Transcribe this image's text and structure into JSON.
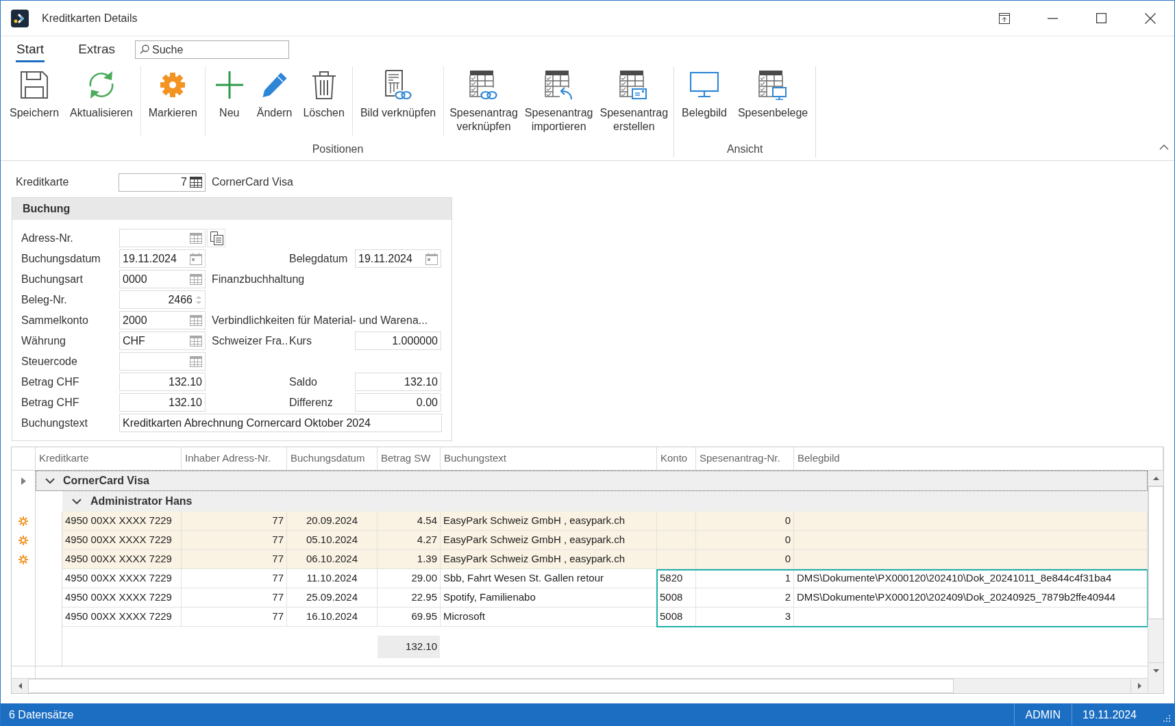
{
  "window": {
    "title": "Kreditkarten Details"
  },
  "ribbon": {
    "tabs": [
      {
        "label": "Start",
        "selected": true
      },
      {
        "label": "Extras",
        "selected": false
      }
    ],
    "search": {
      "placeholder": "Suche"
    },
    "groups": [
      {
        "label": "Positionen",
        "clusters": [
          [
            "Speichern",
            "Aktualisieren"
          ],
          [
            "Markieren"
          ],
          [
            "Neu",
            "Ändern",
            "Löschen"
          ],
          [
            "Bild verknüpfen"
          ],
          [
            "Spesenantrag verknüpfen",
            "Spesenantrag importieren",
            "Spesenantrag erstellen"
          ]
        ]
      },
      {
        "label": "Ansicht",
        "clusters": [
          [
            "Belegbild",
            "Spesenbelege"
          ]
        ]
      }
    ]
  },
  "card": {
    "label": "Kreditkarte",
    "field": {
      "kind": "idlookup",
      "value": "7"
    },
    "description": "CornerCard Visa"
  },
  "booking": {
    "title": "Buchung",
    "rows": [
      {
        "label": "Adress-Nr.",
        "field": {
          "kind": "lookup"
        },
        "action_button": true
      },
      {
        "label": "Buchungsdatum",
        "field": {
          "kind": "date",
          "value": "19.11.2024"
        },
        "action_button": false,
        "right": {
          "label": "Belegdatum",
          "field": {
            "kind": "date",
            "value": "19.11.2024"
          }
        }
      },
      {
        "label": "Buchungsart",
        "field": {
          "kind": "lookup",
          "value": "0000"
        },
        "action_button": false,
        "description": "Finanzbuchhaltung"
      },
      {
        "label": "Beleg-Nr.",
        "field": {
          "kind": "spinner",
          "value": "2466"
        },
        "action_button": false
      },
      {
        "label": "Sammelkonto",
        "field": {
          "kind": "lookup",
          "value": "2000"
        },
        "action_button": false,
        "description": "Verbindlichkeiten für Material- und Warena..."
      },
      {
        "label": "Währung",
        "field": {
          "kind": "lookup",
          "value": "CHF"
        },
        "action_button": false,
        "description": "Schweizer Fra..",
        "right": {
          "label": "Kurs",
          "field": {
            "kind": "amount",
            "value": "1.000000"
          }
        }
      },
      {
        "label": "Steuercode",
        "field": {
          "kind": "lookup"
        },
        "action_button": false
      },
      {
        "label": "Betrag CHF",
        "field": {
          "kind": "amount",
          "value": "132.10"
        },
        "action_button": false,
        "right": {
          "label": "Saldo",
          "field": {
            "kind": "amount",
            "value": "132.10"
          }
        }
      },
      {
        "label": "Betrag CHF",
        "field": {
          "kind": "amount",
          "value": "132.10"
        },
        "action_button": false,
        "right": {
          "label": "Differenz",
          "field": {
            "kind": "amount",
            "value": "0.00"
          }
        }
      },
      {
        "label": "Buchungstext",
        "field": {
          "kind": "text",
          "value": "Kreditkarten Abrechnung Cornercard Oktober 2024"
        },
        "action_button": false
      }
    ]
  },
  "grid": {
    "columns": [
      "Kreditkarte",
      "Inhaber Adress-Nr.",
      "Buchungsdatum",
      "Betrag SW",
      "Buchungstext",
      "Konto",
      "Spesenantrag-Nr.",
      "Belegbild"
    ],
    "groups": [
      {
        "label": "CornerCard Visa",
        "expanded": true,
        "focused": true,
        "children": [
          {
            "label": "Administrator Hans",
            "expanded": true,
            "focused": false,
            "total": "132.10",
            "rows": [
              {
                "card": "4950 00XX XXXX 7229",
                "holder": "77",
                "date": "20.09.2024",
                "amount": "4.54",
                "text": "EasyPark Schweiz GmbH , easypark.ch",
                "request_no": "0",
                "marked": true,
                "selected": false
              },
              {
                "card": "4950 00XX XXXX 7229",
                "holder": "77",
                "date": "05.10.2024",
                "amount": "4.27",
                "text": "EasyPark Schweiz GmbH , easypark.ch",
                "request_no": "0",
                "marked": true,
                "selected": false
              },
              {
                "card": "4950 00XX XXXX 7229",
                "holder": "77",
                "date": "06.10.2024",
                "amount": "1.39",
                "text": "EasyPark Schweiz GmbH , easypark.ch",
                "request_no": "0",
                "marked": true,
                "selected": false
              },
              {
                "card": "4950 00XX XXXX 7229",
                "holder": "77",
                "date": "11.10.2024",
                "amount": "29.00",
                "text": "Sbb, Fahrt Wesen St. Gallen retour",
                "account": "5820",
                "request_no": "1",
                "receipt": "DMS\\Dokumente\\PX000120\\202410\\Dok_20241011_8e844c4f31ba4",
                "marked": false,
                "selected": true
              },
              {
                "card": "4950 00XX XXXX 7229",
                "holder": "77",
                "date": "25.09.2024",
                "amount": "22.95",
                "text": "Spotify, Familienabo",
                "account": "5008",
                "request_no": "2",
                "receipt": "DMS\\Dokumente\\PX000120\\202409\\Dok_20240925_7879b2ffe40944",
                "marked": false,
                "selected": true
              },
              {
                "card": "4950 00XX XXXX 7229",
                "holder": "77",
                "date": "16.10.2024",
                "amount": "69.95",
                "text": "Microsoft",
                "account": "5008",
                "request_no": "3",
                "marked": false,
                "selected": true
              }
            ]
          }
        ]
      }
    ]
  },
  "status_bar": {
    "records": "6 Datensätze",
    "user": "ADMIN",
    "date": "19.11.2024"
  }
}
